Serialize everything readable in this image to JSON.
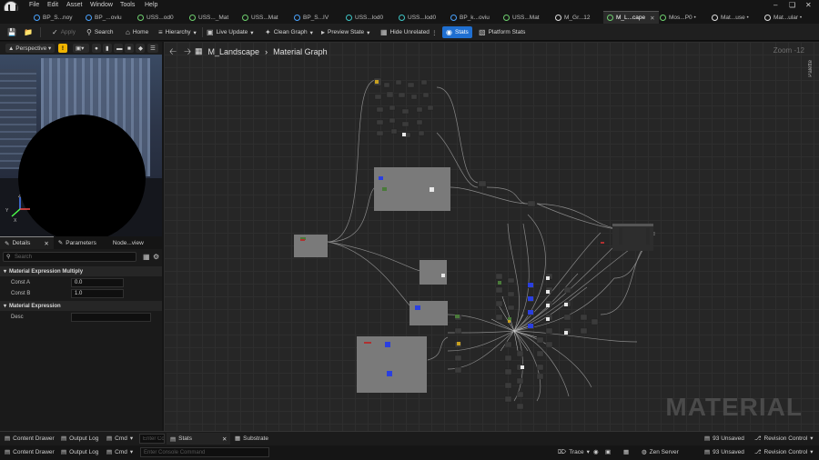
{
  "menu": [
    "File",
    "Edit",
    "Asset",
    "Window",
    "Tools",
    "Help"
  ],
  "tabs": [
    {
      "label": "BP_S...noy",
      "icon": "blueprint-icon",
      "color": "#4aa3ff"
    },
    {
      "label": "BP_...oviu",
      "icon": "blueprint-icon",
      "color": "#4aa3ff"
    },
    {
      "label": "USS...od0",
      "icon": "material-instance-icon",
      "color": "#6fd06f"
    },
    {
      "label": "USS..._Mat",
      "icon": "material-instance-icon",
      "color": "#6fd06f"
    },
    {
      "label": "USS...Mat",
      "icon": "material-instance-icon",
      "color": "#6fd06f"
    },
    {
      "label": "BP_S...IV",
      "icon": "blueprint-icon",
      "color": "#4aa3ff"
    },
    {
      "label": "USS...lod0",
      "icon": "static-mesh-icon",
      "color": "#3fc7c7"
    },
    {
      "label": "USS...lod0",
      "icon": "static-mesh-icon",
      "color": "#3fc7c7"
    },
    {
      "label": "BP_k...oviu",
      "icon": "blueprint-icon",
      "color": "#4aa3ff"
    },
    {
      "label": "USS...Mat",
      "icon": "material-instance-icon",
      "color": "#6fd06f"
    },
    {
      "label": "M_Gr...12",
      "icon": "material-icon",
      "color": "#e0e0e0"
    },
    {
      "label": "M_L...cape",
      "icon": "material-icon",
      "color": "#6fd06f",
      "active": true
    },
    {
      "label": "Mos...P0 •",
      "icon": "material-icon",
      "color": "#6fd06f"
    },
    {
      "label": "Mat...use •",
      "icon": "material-icon",
      "color": "#e0e0e0"
    },
    {
      "label": "Mat...ular •",
      "icon": "material-icon",
      "color": "#e0e0e0"
    }
  ],
  "toolbar": {
    "apply": "Apply",
    "search": "Search",
    "home": "Home",
    "hierarchy": "Hierarchy",
    "live_update": "Live Update",
    "clean_graph": "Clean Graph",
    "preview_state": "Preview State",
    "hide_unrelated": "Hide Unrelated",
    "stats": "Stats",
    "platform_stats": "Platform Stats"
  },
  "viewport": {
    "mode": "Perspective",
    "axis_x": "X",
    "axis_y": "Y",
    "axis_z": "Z"
  },
  "details": {
    "tabs": [
      "Details",
      "Parameters",
      "Node...view"
    ],
    "search_placeholder": "Search",
    "cat1": "Material Expression Multiply",
    "const_a_label": "Const A",
    "const_a": "0.0",
    "const_b_label": "Const B",
    "const_b": "1.0",
    "cat2": "Material Expression",
    "desc_label": "Desc",
    "desc": ""
  },
  "graph": {
    "crumb_root": "M_Landscape",
    "crumb_leaf": "Material Graph",
    "zoom": "Zoom -12",
    "palette": "Palette",
    "watermark": "MATERIAL"
  },
  "bottom1": {
    "content_drawer": "Content Drawer",
    "output_log": "Output Log",
    "cmd": "Cmd",
    "cmd_placeholder": "Enter Console Command",
    "stats_tab": "Stats",
    "substrate_tab": "Substrate",
    "unsaved": "93 Unsaved",
    "revision": "Revision Control"
  },
  "bottom2": {
    "content_drawer": "Content Drawer",
    "output_log": "Output Log",
    "cmd": "Cmd",
    "cmd_placeholder": "Enter Console Command",
    "trace": "Trace",
    "zen": "Zen Server",
    "unsaved": "93 Unsaved",
    "revision": "Revision Control"
  },
  "colors": {
    "accent": "#1f6fd1",
    "graph_bg": "#262626",
    "watermark": "#4a4a4a"
  }
}
